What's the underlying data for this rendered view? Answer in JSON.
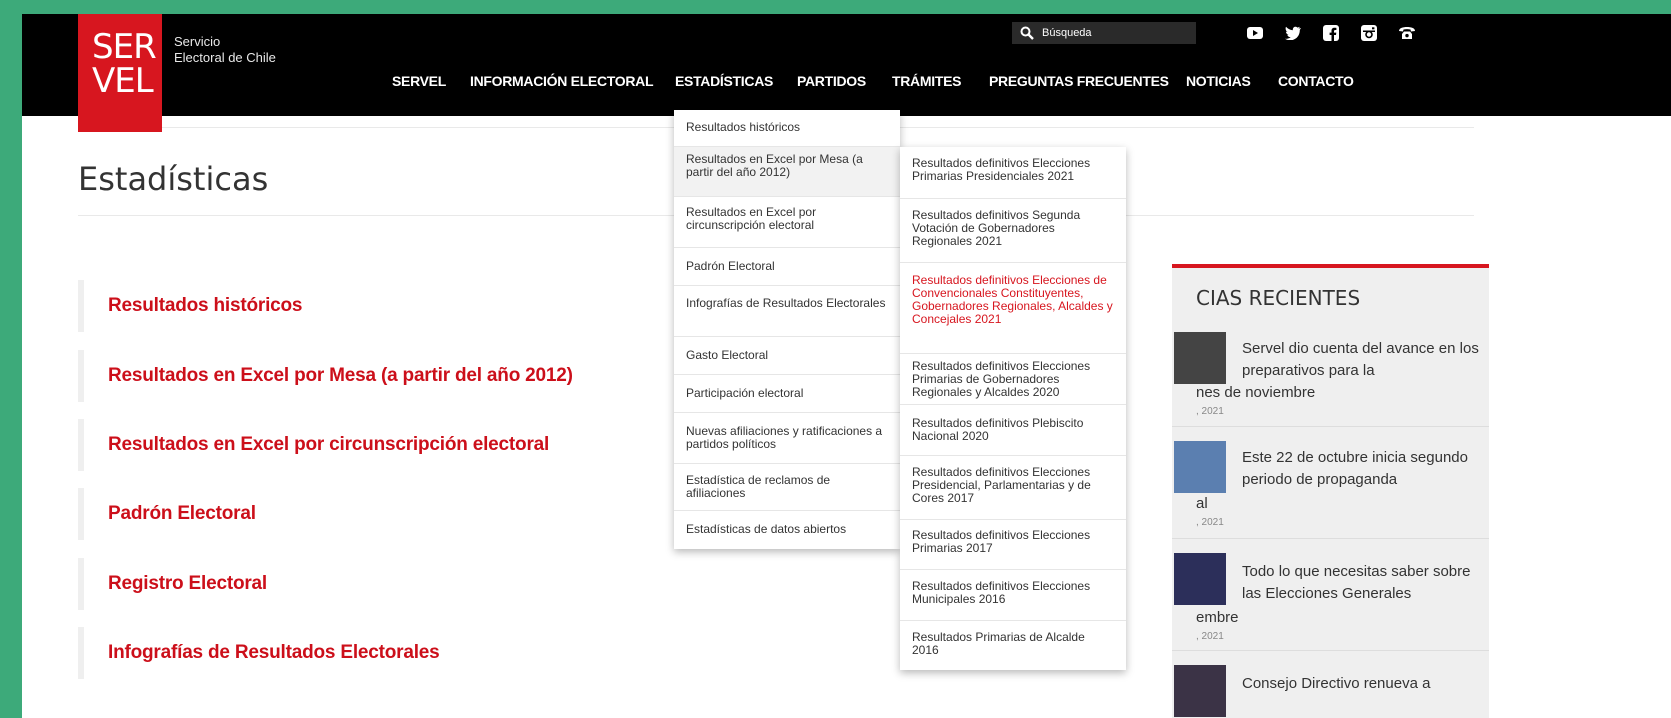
{
  "brand": {
    "logo_line1": "SER",
    "logo_line2": "VEL",
    "tagline_line1": "Servicio",
    "tagline_line2": "Electoral de Chile",
    "accent_color": "#d7161f",
    "header_color": "#000000"
  },
  "search": {
    "placeholder": "Búsqueda",
    "icon": "search-icon"
  },
  "social_icons": [
    "youtube-icon",
    "twitter-icon",
    "facebook-icon",
    "instagram-icon",
    "phone-icon"
  ],
  "nav": {
    "items": [
      "SERVEL",
      "INFORMACIÓN ELECTORAL",
      "ESTADÍSTICAS",
      "PARTIDOS",
      "TRÁMITES",
      "PREGUNTAS FRECUENTES",
      "NOTICIAS",
      "CONTACTO"
    ]
  },
  "page": {
    "title": "Estadísticas",
    "links": [
      "Resultados históricos",
      "Resultados en Excel por Mesa (a partir del año 2012)",
      "Resultados en Excel por circunscripción electoral",
      "Padrón Electoral",
      "Registro Electoral",
      "Infografías de Resultados Electorales"
    ]
  },
  "dropdown_main": {
    "items": [
      "Resultados históricos",
      "Resultados en Excel por Mesa (a partir del año 2012)",
      "Resultados en Excel por circunscripción electoral",
      "Padrón Electoral",
      "Infografías de Resultados Electorales",
      "Gasto Electoral",
      "Participación electoral",
      "Nuevas afiliaciones y ratificaciones a partidos políticos",
      "Estadística de reclamos de afiliaciones",
      "Estadísticas de datos abiertos"
    ]
  },
  "dropdown_sub": {
    "items": [
      "Resultados definitivos Elecciones Primarias Presidenciales 2021",
      "Resultados definitivos Segunda Votación de Gobernadores Regionales 2021",
      "Resultados definitivos Elecciones de Convencionales Constituyentes, Gobernadores Regionales, Alcaldes y Concejales 2021",
      "Resultados definitivos Elecciones Primarias de Gobernadores Regionales y Alcaldes 2020",
      "Resultados definitivos Plebiscito Nacional 2020",
      "Resultados definitivos Elecciones Presidencial, Parlamentarias y de Cores 2017",
      "Resultados definitivos Elecciones Primarias 2017",
      "Resultados definitivos Elecciones Municipales 2016",
      "Resultados Primarias de Alcalde 2016"
    ]
  },
  "news": {
    "heading": "CIAS RECIENTES",
    "items": [
      {
        "title": "Servel dio cuenta del avance en los preparativos para la",
        "cont": "nes de noviembre",
        "date": ", 2021"
      },
      {
        "title": "Este 22 de octubre inicia segundo periodo de propaganda",
        "cont": "al",
        "date": ", 2021"
      },
      {
        "title": "Todo lo que necesitas saber sobre las Elecciones Generales",
        "cont": "embre",
        "date": ", 2021"
      },
      {
        "title": "Consejo Directivo renueva a",
        "cont": "",
        "date": ""
      }
    ]
  }
}
